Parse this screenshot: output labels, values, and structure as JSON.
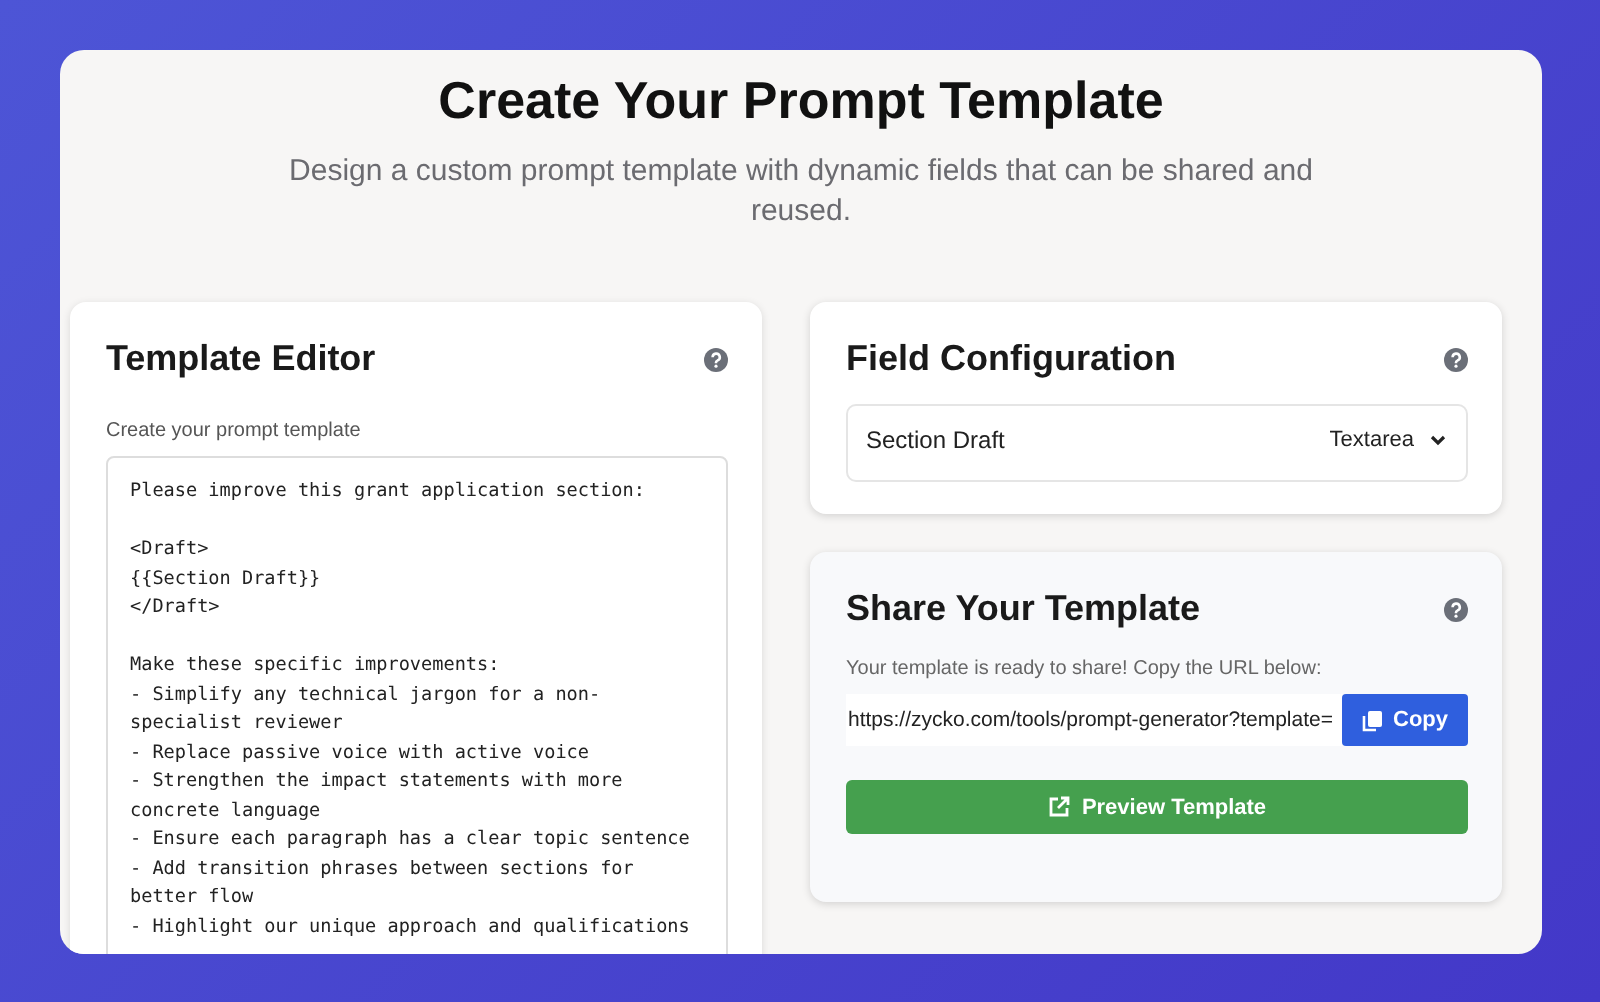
{
  "header": {
    "title": "Create Your Prompt Template",
    "subtitle": "Design a custom prompt template with dynamic fields that can be shared and reused."
  },
  "editor": {
    "title": "Template Editor",
    "label": "Create your prompt template",
    "value": "Please improve this grant application section:\n\n<Draft>\n{{Section Draft}}\n</Draft>\n\nMake these specific improvements:\n- Simplify any technical jargon for a non-specialist reviewer\n- Replace passive voice with active voice\n- Strengthen the impact statements with more concrete language\n- Ensure each paragraph has a clear topic sentence\n- Add transition phrases between sections for better flow\n- Highlight our unique approach and qualifications"
  },
  "field_configuration": {
    "title": "Field Configuration",
    "fields": [
      {
        "name": "Section Draft",
        "type": "Textarea"
      }
    ]
  },
  "share": {
    "title": "Share Your Template",
    "message": "Your template is ready to share! Copy the URL below:",
    "url": "https://zycko.com/tools/prompt-generator?template=",
    "copy_button": "Copy",
    "preview_button": "Preview Template"
  }
}
